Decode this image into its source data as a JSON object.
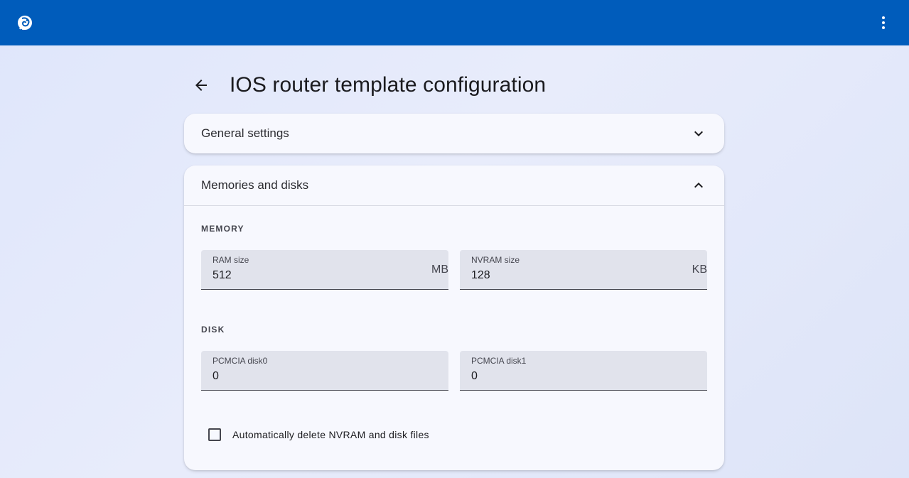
{
  "appbar": {
    "logo_icon": "gns3-chameleon-logo-icon",
    "menu_icon": "more-vert-icon",
    "color": "#005cbb"
  },
  "page": {
    "title": "IOS router template configuration",
    "back_icon": "arrow-back-icon"
  },
  "panels": {
    "general": {
      "title": "General settings",
      "expanded": false
    },
    "memory": {
      "title": "Memories and disks",
      "expanded": true,
      "memory_section": "MEMORY",
      "disk_section": "DISK",
      "fields": {
        "ram": {
          "label": "RAM size",
          "value": "512",
          "suffix": "MB"
        },
        "nvram": {
          "label": "NVRAM size",
          "value": "128",
          "suffix": "KB"
        },
        "disk0": {
          "label": "PCMCIA disk0",
          "value": "0"
        },
        "disk1": {
          "label": "PCMCIA disk1",
          "value": "0"
        }
      },
      "auto_delete": {
        "label": "Automatically delete NVRAM and disk files",
        "checked": false
      }
    }
  }
}
